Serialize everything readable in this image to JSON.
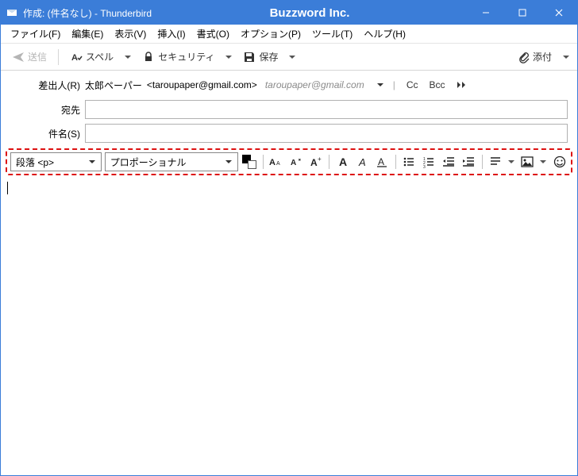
{
  "titlebar": {
    "title": "作成: (件名なし) - Thunderbird",
    "brand": "Buzzword Inc."
  },
  "menu": {
    "file": "ファイル(F)",
    "edit": "編集(E)",
    "view": "表示(V)",
    "insert": "挿入(I)",
    "format": "書式(O)",
    "options": "オプション(P)",
    "tools": "ツール(T)",
    "help": "ヘルプ(H)"
  },
  "toolbar": {
    "send": "送信",
    "spell": "スペル",
    "security": "セキュリティ",
    "save": "保存",
    "attach": "添付"
  },
  "from": {
    "label": "差出人(R)",
    "name": "太郎ペーパー",
    "email": "<taroupaper@gmail.com>",
    "alt": "taroupaper@gmail.com",
    "cc": "Cc",
    "bcc": "Bcc"
  },
  "to": {
    "label": "宛先",
    "value": ""
  },
  "subject": {
    "label": "件名(S)",
    "value": ""
  },
  "format_toolbar": {
    "paragraph": "段落 <p>",
    "font": "プロポーショナル"
  }
}
